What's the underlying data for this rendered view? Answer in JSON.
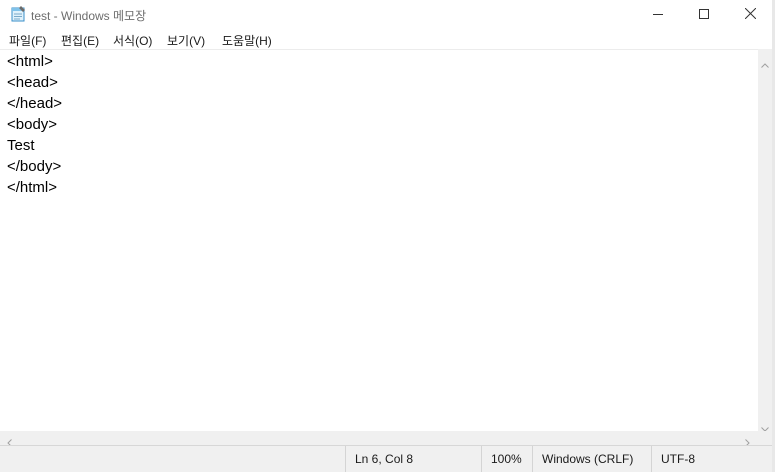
{
  "window": {
    "title": "test - Windows 메모장"
  },
  "menu": {
    "items": [
      "파일(F)",
      "편집(E)",
      "서식(O)",
      "보기(V)",
      "도움말(H)"
    ]
  },
  "editor": {
    "lines": [
      "<html>",
      "<head>",
      "</head>",
      "<body>",
      "Test",
      "</body>",
      "</html>"
    ]
  },
  "status": {
    "position": "Ln 6, Col 8",
    "zoom": "100%",
    "line_ending": "Windows (CRLF)",
    "encoding": "UTF-8"
  },
  "icons": {
    "app": "notepad-icon",
    "minimize": "minimize-icon",
    "maximize": "maximize-icon",
    "close": "close-icon",
    "scroll_up": "chevron-up-icon",
    "scroll_down": "chevron-down-icon",
    "scroll_left": "chevron-left-icon",
    "scroll_right": "chevron-right-icon"
  }
}
